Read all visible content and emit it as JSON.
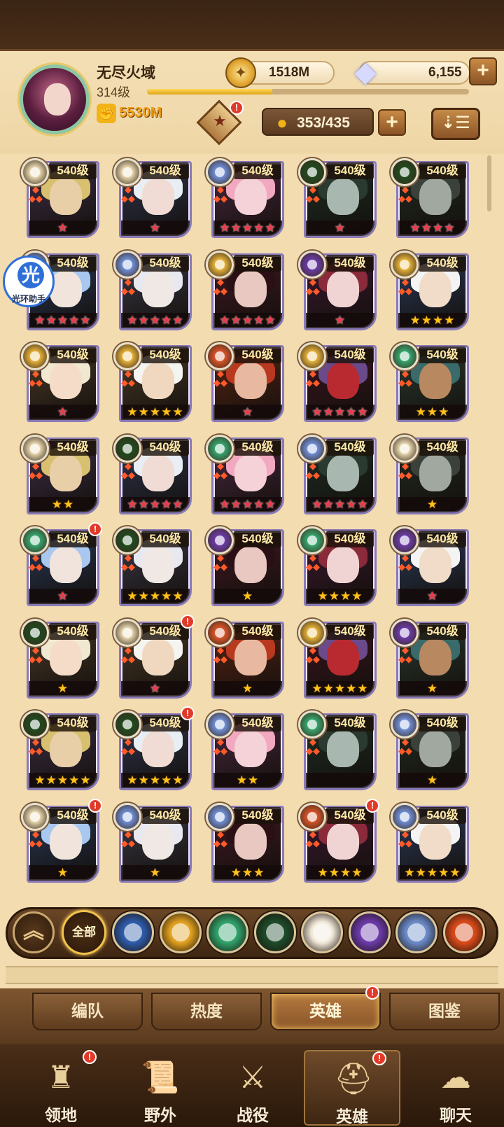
{
  "player": {
    "name": "无尽火域",
    "level": "314级",
    "xp_fraction": 0.39,
    "power": "5530M"
  },
  "currency": {
    "gold": "1518M",
    "gems": "6,155"
  },
  "heroes_count": "353/435",
  "assistant": {
    "glyph": "光",
    "label": "光环助手"
  },
  "heroes": [
    {
      "level": "540级",
      "stars": 1,
      "star_color": "red",
      "faction": "light",
      "alert": false
    },
    {
      "level": "540级",
      "stars": 1,
      "star_color": "red",
      "faction": "light",
      "alert": false
    },
    {
      "level": "540级",
      "stars": 5,
      "star_color": "red",
      "faction": "celestial",
      "alert": false
    },
    {
      "level": "540级",
      "stars": 1,
      "star_color": "red",
      "faction": "green",
      "alert": false
    },
    {
      "level": "540级",
      "stars": 4,
      "star_color": "red",
      "faction": "green",
      "alert": false
    },
    {
      "level": "540级",
      "stars": 5,
      "star_color": "red",
      "faction": "celestial",
      "alert": false
    },
    {
      "level": "540级",
      "stars": 5,
      "star_color": "red",
      "faction": "celestial",
      "alert": false
    },
    {
      "level": "540级",
      "stars": 5,
      "star_color": "red",
      "faction": "gold",
      "alert": false
    },
    {
      "level": "540级",
      "stars": 1,
      "star_color": "red",
      "faction": "purple",
      "alert": false
    },
    {
      "level": "540级",
      "stars": 4,
      "star_color": "gold",
      "faction": "gold",
      "alert": false
    },
    {
      "level": "540级",
      "stars": 1,
      "star_color": "red",
      "faction": "gold",
      "alert": false
    },
    {
      "level": "540级",
      "stars": 5,
      "star_color": "gold",
      "faction": "gold",
      "alert": false
    },
    {
      "level": "540级",
      "stars": 1,
      "star_color": "red",
      "faction": "fire",
      "alert": false
    },
    {
      "level": "540级",
      "stars": 5,
      "star_color": "red",
      "faction": "gold",
      "alert": false
    },
    {
      "level": "540级",
      "stars": 3,
      "star_color": "gold",
      "faction": "forest",
      "alert": false
    },
    {
      "level": "540级",
      "stars": 2,
      "star_color": "gold",
      "faction": "light",
      "alert": false
    },
    {
      "level": "540级",
      "stars": 5,
      "star_color": "red",
      "faction": "green",
      "alert": false
    },
    {
      "level": "540级",
      "stars": 5,
      "star_color": "red",
      "faction": "forest",
      "alert": false
    },
    {
      "level": "540级",
      "stars": 5,
      "star_color": "red",
      "faction": "celestial",
      "alert": false
    },
    {
      "level": "540级",
      "stars": 1,
      "star_color": "gold",
      "faction": "light",
      "alert": false
    },
    {
      "level": "540级",
      "stars": 1,
      "star_color": "red",
      "faction": "forest",
      "alert": true
    },
    {
      "level": "540级",
      "stars": 5,
      "star_color": "gold",
      "faction": "green",
      "alert": false
    },
    {
      "level": "540级",
      "stars": 1,
      "star_color": "gold",
      "faction": "purple",
      "alert": false
    },
    {
      "level": "540级",
      "stars": 4,
      "star_color": "gold",
      "faction": "forest",
      "alert": false
    },
    {
      "level": "540级",
      "stars": 1,
      "star_color": "red",
      "faction": "purple",
      "alert": false
    },
    {
      "level": "540级",
      "stars": 1,
      "star_color": "gold",
      "faction": "green",
      "alert": false
    },
    {
      "level": "540级",
      "stars": 1,
      "star_color": "red",
      "faction": "light",
      "alert": true
    },
    {
      "level": "540级",
      "stars": 1,
      "star_color": "gold",
      "faction": "fire",
      "alert": false
    },
    {
      "level": "540级",
      "stars": 5,
      "star_color": "gold",
      "faction": "gold",
      "alert": false
    },
    {
      "level": "540级",
      "stars": 1,
      "star_color": "gold",
      "faction": "purple",
      "alert": false
    },
    {
      "level": "540级",
      "stars": 5,
      "star_color": "gold",
      "faction": "green",
      "alert": false
    },
    {
      "level": "540级",
      "stars": 5,
      "star_color": "gold",
      "faction": "green",
      "alert": true
    },
    {
      "level": "540级",
      "stars": 2,
      "star_color": "gold",
      "faction": "celestial",
      "alert": false
    },
    {
      "level": "540级",
      "stars": 0,
      "star_color": "gold",
      "faction": "forest",
      "alert": false
    },
    {
      "level": "540级",
      "stars": 1,
      "star_color": "gold",
      "faction": "celestial",
      "alert": false
    },
    {
      "level": "540级",
      "stars": 1,
      "star_color": "gold",
      "faction": "light",
      "alert": true
    },
    {
      "level": "540级",
      "stars": 1,
      "star_color": "gold",
      "faction": "celestial",
      "alert": false
    },
    {
      "level": "540级",
      "stars": 3,
      "star_color": "gold",
      "faction": "celestial",
      "alert": false
    },
    {
      "level": "540级",
      "stars": 4,
      "star_color": "gold",
      "faction": "fire",
      "alert": true
    },
    {
      "level": "540级",
      "stars": 5,
      "star_color": "gold",
      "faction": "celestial",
      "alert": false
    }
  ],
  "filters": {
    "all_label": "全部",
    "items": [
      {
        "name": "lightbearer-filter",
        "color": "#2e5aa8"
      },
      {
        "name": "mauler-filter",
        "color": "#e0a020"
      },
      {
        "name": "wilder-filter",
        "color": "#2fa06a"
      },
      {
        "name": "graveborn-filter",
        "color": "#1d4a2a"
      },
      {
        "name": "celestial-filter",
        "color": "#f0e8d8"
      },
      {
        "name": "hypogean-filter",
        "color": "#6a3aa8"
      },
      {
        "name": "dimensional-filter",
        "color": "#6a8ac8"
      },
      {
        "name": "fire-filter",
        "color": "#d84a1a"
      }
    ]
  },
  "subtabs": [
    "编队",
    "热度",
    "英雄",
    "图鉴"
  ],
  "active_subtab": 2,
  "nav": [
    {
      "label": "领地",
      "icon": "castle-icon",
      "alert": true
    },
    {
      "label": "野外",
      "icon": "map-scroll-icon",
      "alert": false
    },
    {
      "label": "战役",
      "icon": "sword-icon",
      "alert": false
    },
    {
      "label": "英雄",
      "icon": "hero-helmet-icon",
      "alert": true,
      "active": true
    },
    {
      "label": "聊天",
      "icon": "chat-bubble-icon",
      "alert": false
    }
  ],
  "colors": {
    "accent_gold": "#f0a018",
    "alert_red": "#e23a2a",
    "frame_purple": "#8a7ab8"
  }
}
